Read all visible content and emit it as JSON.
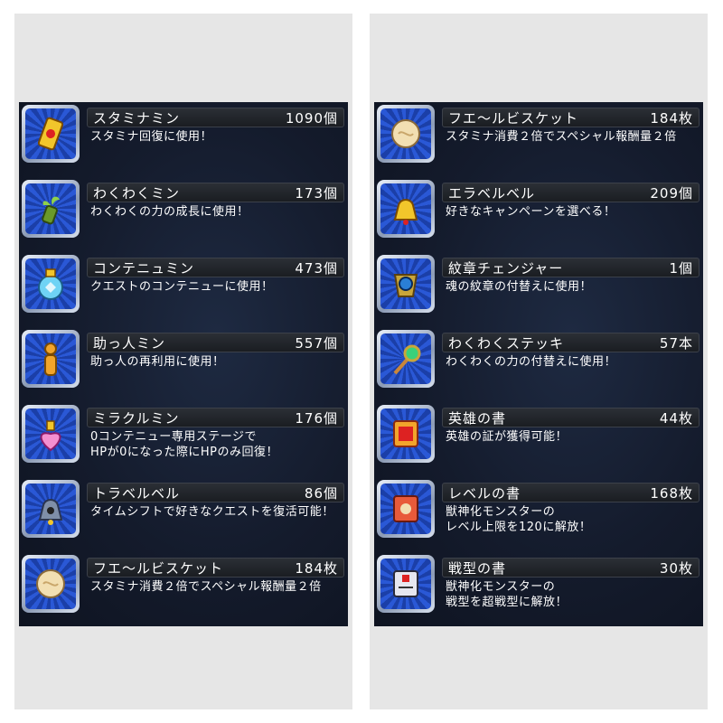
{
  "left_panel": {
    "items": [
      {
        "name": "スタミナミン",
        "count": "1090個",
        "desc": "スタミナ回復に使用！",
        "icon": "stamina-can-icon"
      },
      {
        "name": "わくわくミン",
        "count": "173個",
        "desc": "わくわくの力の成長に使用！",
        "icon": "sprout-bottle-icon"
      },
      {
        "name": "コンテニュミン",
        "count": "473個",
        "desc": "クエストのコンテニューに使用！",
        "icon": "blue-potion-icon"
      },
      {
        "name": "助っ人ミン",
        "count": "557個",
        "desc": "助っ人の再利用に使用！",
        "icon": "helper-figure-icon"
      },
      {
        "name": "ミラクルミン",
        "count": "176個",
        "desc": "0コンテニュー専用ステージで\nHPが0になった際にHPのみ回復！",
        "icon": "pink-potion-icon"
      },
      {
        "name": "トラベルベル",
        "count": "86個",
        "desc": "タイムシフトで好きなクエストを復活可能！",
        "icon": "travel-bell-icon"
      },
      {
        "name": "フエ〜ルビスケット",
        "count": "184枚",
        "desc": "スタミナ消費２倍でスペシャル報酬量２倍",
        "icon": "biscuit-icon"
      }
    ]
  },
  "right_panel": {
    "items": [
      {
        "name": "フエ〜ルビスケット",
        "count": "184枚",
        "desc": "スタミナ消費２倍でスペシャル報酬量２倍",
        "icon": "biscuit-icon"
      },
      {
        "name": "エラベルベル",
        "count": "209個",
        "desc": "好きなキャンペーンを選べる！",
        "icon": "gold-bell-icon"
      },
      {
        "name": "紋章チェンジャー",
        "count": "1個",
        "desc": "魂の紋章の付替えに使用！",
        "icon": "emblem-changer-icon"
      },
      {
        "name": "わくわくステッキ",
        "count": "57本",
        "desc": "わくわくの力の付替えに使用！",
        "icon": "wand-icon"
      },
      {
        "name": "英雄の書",
        "count": "44枚",
        "desc": "英雄の証が獲得可能！",
        "icon": "hero-scroll-icon"
      },
      {
        "name": "レベルの書",
        "count": "168枚",
        "desc": "獣神化モンスターの\nレベル上限を120に解放！",
        "icon": "level-scroll-icon"
      },
      {
        "name": "戦型の書",
        "count": "30枚",
        "desc": "獣神化モンスターの\n戦型を超戦型に解放！",
        "icon": "battle-scroll-icon"
      }
    ]
  }
}
